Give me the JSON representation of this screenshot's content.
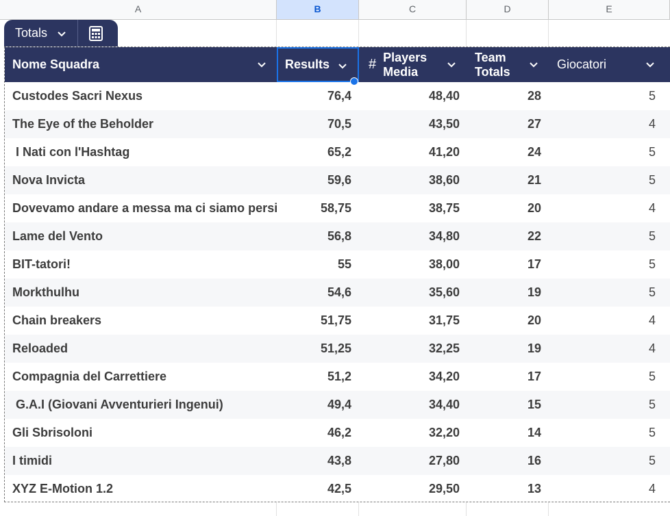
{
  "sheet": {
    "column_headers": [
      "A",
      "B",
      "C",
      "D",
      "E"
    ],
    "selected_column": "B"
  },
  "table_tab": {
    "name": "Totals",
    "chevron_icon": "chevron-down-icon",
    "calculator_icon": "calculator-icon"
  },
  "table": {
    "headers": {
      "name": "Nome Squadra",
      "results": "Results",
      "players_media": "Players\nMedia",
      "team_totals": "Team\nTotals",
      "giocatori": "Giocatori",
      "number_type_symbol": "#"
    },
    "rows": [
      {
        "name": "Custodes Sacri Nexus",
        "results": "76,4",
        "players_media": "48,40",
        "team_totals": "28",
        "giocatori": "5"
      },
      {
        "name": "The Eye of the Beholder",
        "results": "70,5",
        "players_media": "43,50",
        "team_totals": "27",
        "giocatori": "4"
      },
      {
        "name": " I Nati con l'Hashtag",
        "results": "65,2",
        "players_media": "41,20",
        "team_totals": "24",
        "giocatori": "5"
      },
      {
        "name": "Nova Invicta",
        "results": "59,6",
        "players_media": "38,60",
        "team_totals": "21",
        "giocatori": "5"
      },
      {
        "name": "Dovevamo andare a messa ma ci siamo persi",
        "results": "58,75",
        "players_media": "38,75",
        "team_totals": "20",
        "giocatori": "4"
      },
      {
        "name": "Lame del Vento",
        "results": "56,8",
        "players_media": "34,80",
        "team_totals": "22",
        "giocatori": "5"
      },
      {
        "name": "BIT-tatori!",
        "results": "55",
        "players_media": "38,00",
        "team_totals": "17",
        "giocatori": "5"
      },
      {
        "name": "Morkthulhu",
        "results": "54,6",
        "players_media": "35,60",
        "team_totals": "19",
        "giocatori": "5"
      },
      {
        "name": "Chain breakers",
        "results": "51,75",
        "players_media": "31,75",
        "team_totals": "20",
        "giocatori": "4"
      },
      {
        "name": "Reloaded",
        "results": "51,25",
        "players_media": "32,25",
        "team_totals": "19",
        "giocatori": "4"
      },
      {
        "name": "Compagnia del Carrettiere",
        "results": "51,2",
        "players_media": "34,20",
        "team_totals": "17",
        "giocatori": "5"
      },
      {
        "name": " G.A.I (Giovani Avventurieri Ingenui)",
        "results": "49,4",
        "players_media": "34,40",
        "team_totals": "15",
        "giocatori": "5"
      },
      {
        "name": "Gli Sbrisoloni",
        "results": "46,2",
        "players_media": "32,20",
        "team_totals": "14",
        "giocatori": "5"
      },
      {
        "name": "I timidi",
        "results": "43,8",
        "players_media": "27,80",
        "team_totals": "16",
        "giocatori": "5"
      },
      {
        "name": "XYZ E-Motion 1.2",
        "results": "42,5",
        "players_media": "29,50",
        "team_totals": "13",
        "giocatori": "4"
      }
    ]
  },
  "colors": {
    "header_bg": "#2c3560",
    "selection": "#1a73e8",
    "selected_col_header_bg": "#d3e3fd"
  }
}
